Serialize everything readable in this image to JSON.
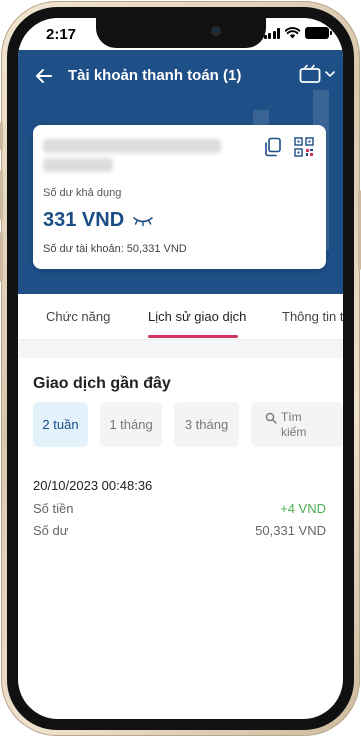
{
  "status_bar": {
    "time": "2:17"
  },
  "header": {
    "title": "Tài khoản thanh toán (1)"
  },
  "account_card": {
    "available_label": "Số dư khả dụng",
    "available_balance": "331 VND",
    "account_balance_text": "Số dư tài khoản: 50,331 VND"
  },
  "tabs": [
    {
      "label": "Chức năng"
    },
    {
      "label": "Lịch sử giao dịch"
    },
    {
      "label": "Thông tin tà"
    }
  ],
  "recent": {
    "title": "Giao dịch gần đây",
    "filters": [
      {
        "label": "2 tuần"
      },
      {
        "label": "1 tháng"
      },
      {
        "label": "3 tháng"
      }
    ],
    "search_line1": "Tìm",
    "search_line2": "kiếm"
  },
  "transaction": {
    "datetime": "20/10/2023 00:48:36",
    "amount_label": "Số tiền",
    "amount_value": "+4 VND",
    "balance_label": "Số dư",
    "balance_value": "50,331 VND"
  },
  "colors": {
    "header": "#1e4f86",
    "balance": "#1a4c86",
    "tab_indicator": "#d2345c",
    "positive": "#4bae4f"
  }
}
